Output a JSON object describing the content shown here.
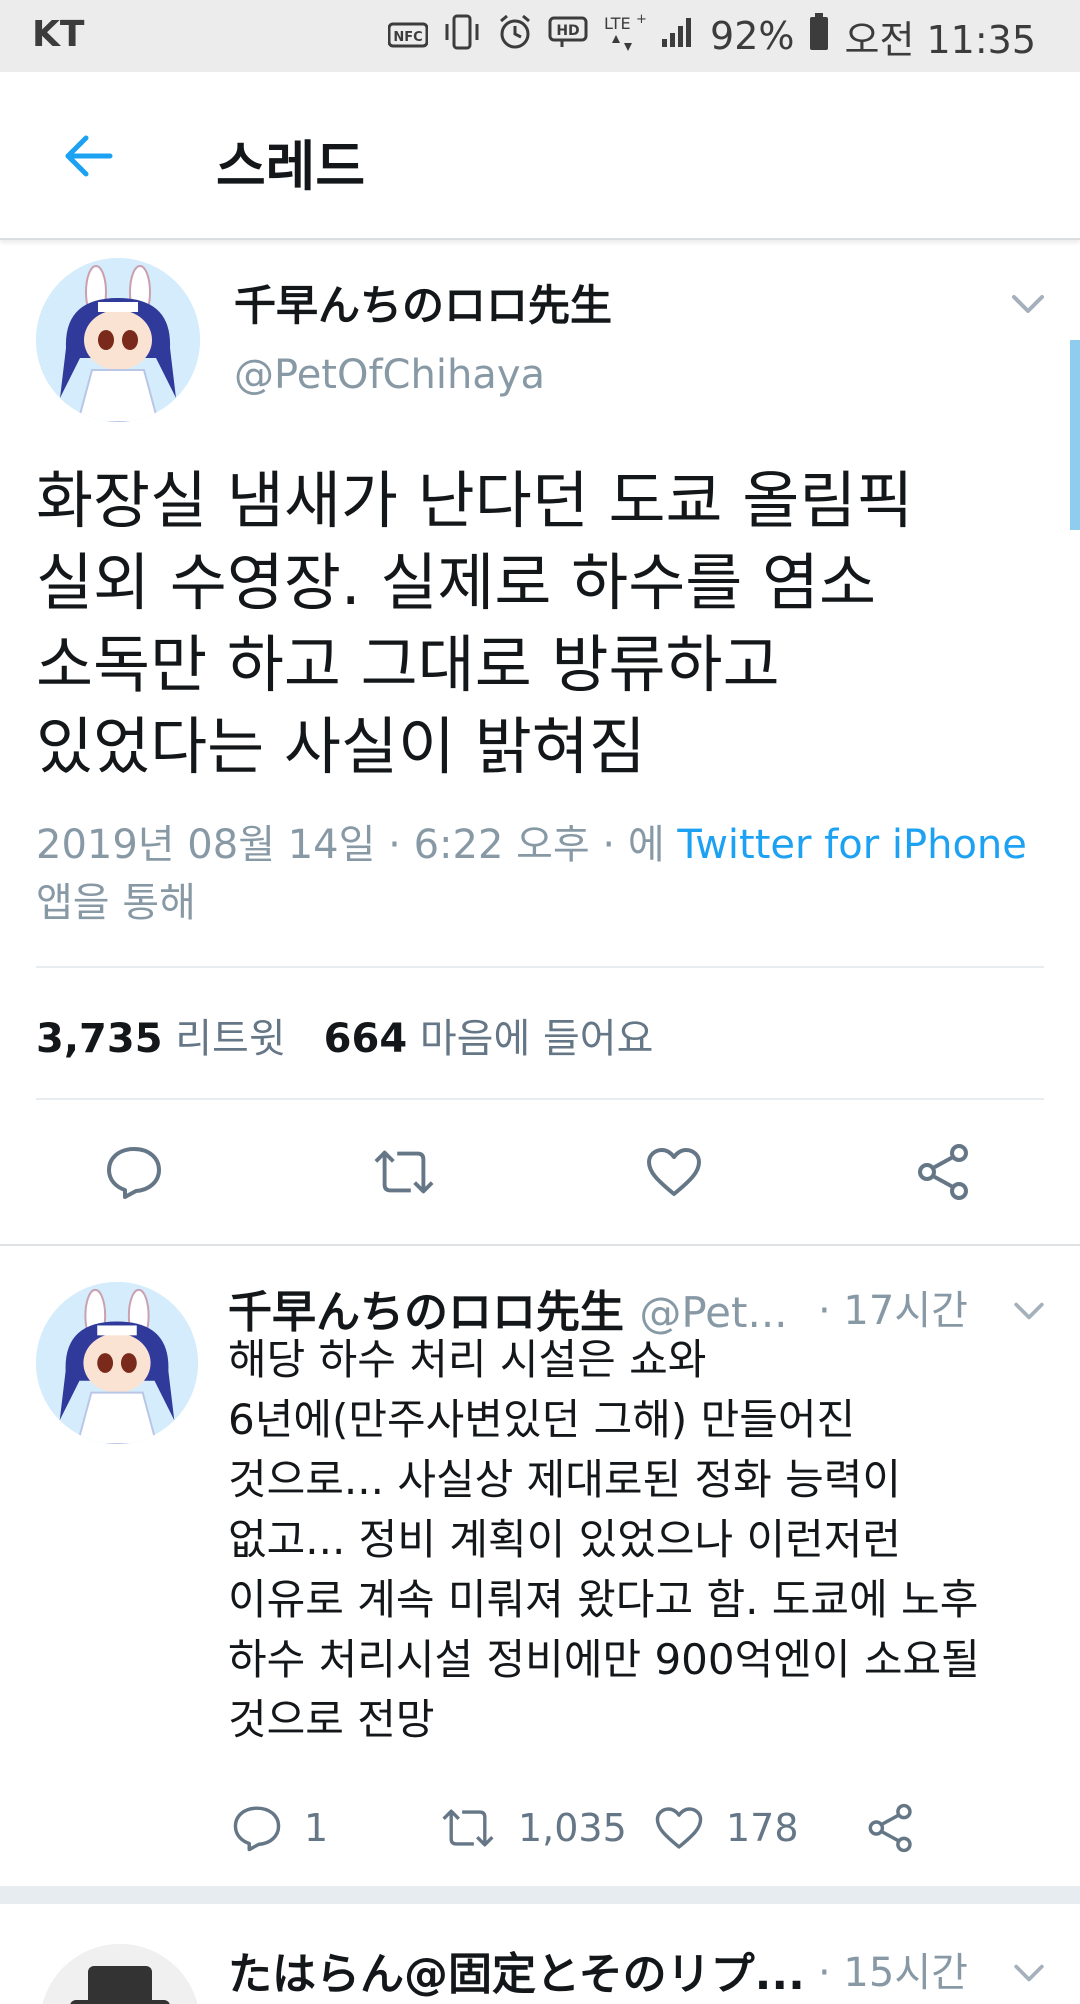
{
  "status_bar": {
    "carrier": "KT",
    "nfc": "NFC",
    "battery": "92%",
    "time": "오전 11:35",
    "icons": [
      "nfc-icon",
      "vibrate-icon",
      "alarm-icon",
      "hd-icon",
      "lte-icon",
      "signal-icon",
      "battery-icon"
    ]
  },
  "header": {
    "title": "스레드"
  },
  "main_tweet": {
    "display_name": "千早んちのロロ先生",
    "handle": "@PetOfChihaya",
    "text_lines": [
      "화장실 냄새가 난다던 도쿄 올림픽",
      "실외 수영장. 실제로 하수를 염소",
      "소독만 하고 그대로 방류하고",
      "있었다는 사실이 밝혀짐"
    ],
    "date": "2019년 08월 14일 · 6:22 오후 · 에 ",
    "source": "Twitter for iPhone",
    "via": "앱을 통해",
    "retweets_count": "3,735",
    "retweets_label": "리트윗",
    "likes_count": "664",
    "likes_label": "마음에 들어요"
  },
  "reply_tweet": {
    "display_name": "千早んちのロロ先生",
    "handle": "@Pet...",
    "time": "· 17시간",
    "text_lines": [
      "해당 하수 처리 시설은 쇼와",
      "6년에(만주사변있던 그해) 만들어진",
      "것으로... 사실상 제대로된 정화 능력이",
      "없고... 정비 계획이 있었으나 이런저런",
      "이유로 계속 미뤄져 왔다고 함. 도쿄에 노후",
      "하수 처리시설 정비에만 900억엔이 소요될",
      "것으로 전망"
    ],
    "reply_count": "1",
    "retweet_count": "1,035",
    "like_count": "178"
  },
  "next_tweet": {
    "display_name": "たはらん@固定とそのリプ...",
    "time": "· 15시간"
  },
  "colors": {
    "accent": "#1da1f2",
    "secondary_text": "#8899a6",
    "primary_text": "#14171a",
    "icon_gray": "#657786"
  }
}
